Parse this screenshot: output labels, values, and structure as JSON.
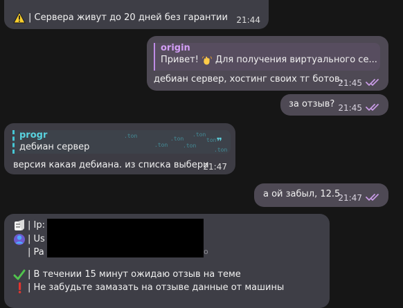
{
  "conversation": {
    "messages": [
      {
        "id": "m1",
        "sender": "incoming",
        "text": "| Сервера живут до 20 дней без гарантии",
        "time": "21:44"
      },
      {
        "id": "m2",
        "sender": "outgoing",
        "reply": {
          "author": "origin",
          "text": "Привет!  Для получения виртуального се..."
        },
        "text": "дебиан сервер, хостинг своих тг ботов.",
        "time": "21:45"
      },
      {
        "id": "m3",
        "sender": "outgoing",
        "text": "за отзыв?",
        "time": "21:45"
      },
      {
        "id": "m4",
        "sender": "incoming",
        "reply": {
          "author": "progr",
          "text": "дебиан сервер"
        },
        "text": "версия какая дебиана. из списка выбери",
        "time": "21:47",
        "watermarks": [
          ".ton",
          ".ton",
          ".ton",
          "ton",
          ".ton",
          ".ton",
          ".ton"
        ]
      },
      {
        "id": "m5",
        "sender": "outgoing",
        "text": "а ой забыл, 12.5",
        "time": "21:47"
      },
      {
        "id": "m6",
        "sender": "incoming",
        "lines": [
          "| Ip:",
          "| Us",
          "| Pa",
          "| В течении 15 минут ожидаю отзыв на теме",
          "| Не забудьте замазать на отзыве данные от машины"
        ],
        "fragment": "о"
      }
    ]
  },
  "colors": {
    "background": "#161616",
    "incoming_bubble": "#3e3e46",
    "outgoing_bubble": "#4e4954",
    "reply_origin": "#d39ef5",
    "reply_progr": "#59d3df",
    "read_checks": "#c89be5"
  },
  "icons": {
    "warning": "warning-icon",
    "wave": "waving-hand-icon",
    "read": "double-check-icon",
    "server": "server-icon",
    "user": "user-avatar-icon",
    "confirm": "green-check-icon",
    "alert": "red-exclamation-icon"
  }
}
